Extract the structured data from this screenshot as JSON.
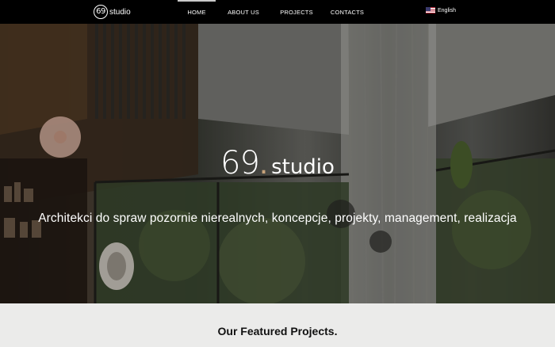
{
  "logo": {
    "mark": "69",
    "text": "studio"
  },
  "nav": {
    "items": [
      {
        "label": "HOME",
        "active": true
      },
      {
        "label": "ABOUT US",
        "active": false
      },
      {
        "label": "PROJECTS",
        "active": false
      },
      {
        "label": "CONTACTS",
        "active": false
      }
    ]
  },
  "language": {
    "label": "English",
    "flag_icon": "us-flag-icon"
  },
  "hero": {
    "brand_number": "69",
    "brand_dot": ".",
    "brand_word": "studio",
    "tagline": "Architekci do spraw pozornie nierealnych, koncepcje, projekty, management, realizacja"
  },
  "featured": {
    "title": "Our Featured Projects."
  },
  "colors": {
    "topbar": "#000000",
    "section_bg": "#ebebea",
    "accent_dot": "#c7a27a"
  }
}
